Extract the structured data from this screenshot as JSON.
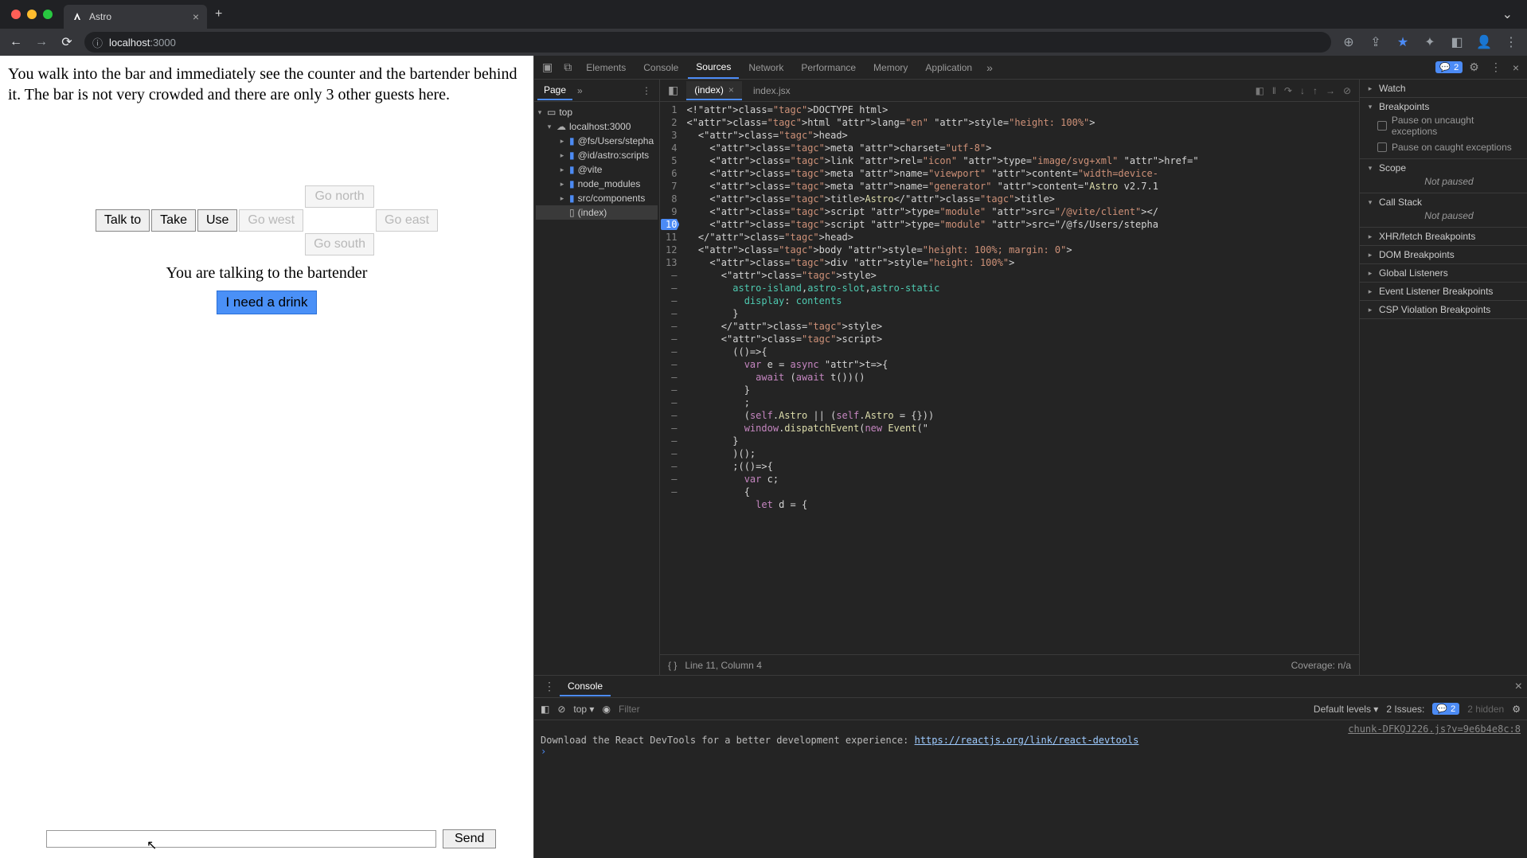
{
  "tab": {
    "title": "Astro"
  },
  "url": {
    "host": "localhost",
    "port": ":3000"
  },
  "page": {
    "narrative": "You walk into the bar and immediately see the counter and the bartender behind it. The bar is not very crowded and there are only 3 other guests here.",
    "actions": {
      "talk": "Talk to",
      "take": "Take",
      "use": "Use"
    },
    "compass": {
      "north": "Go north",
      "south": "Go south",
      "east": "Go east",
      "west": "Go west"
    },
    "talking_to": "You are talking to the bartender",
    "dialog_option": "I need a drink",
    "send": "Send"
  },
  "devtools": {
    "tabs": [
      "Elements",
      "Console",
      "Sources",
      "Network",
      "Performance",
      "Memory",
      "Application"
    ],
    "active_tab": "Sources",
    "issues_count": "2",
    "file_nav_tab": "Page",
    "tree": {
      "top": "top",
      "host": "localhost:3000",
      "folders": [
        "@fs/Users/stepha",
        "@id/astro:scripts",
        "@vite",
        "node_modules",
        "src/components"
      ],
      "file": "(index)"
    },
    "editor_tabs": [
      "(index)",
      "index.jsx"
    ],
    "active_editor_tab": "(index)",
    "line_numbers": [
      "1",
      "2",
      "3",
      "4",
      "5",
      "6",
      "7",
      "8",
      "9",
      "10",
      "11",
      "12",
      "13",
      "–",
      "–",
      "–",
      "–",
      "–",
      "–",
      "–",
      "–",
      "–",
      "–",
      "–",
      "–",
      "–",
      "–",
      "–",
      "–",
      "–",
      "–"
    ],
    "breakpoint_line": "10",
    "status": {
      "cursor": "Line 11, Column 4",
      "coverage": "Coverage: n/a"
    },
    "code_lines": [
      "<!DOCTYPE html>",
      "<html lang=\"en\" style=\"height: 100%\">",
      "  <head>",
      "    <meta charset=\"utf-8\">",
      "    <link rel=\"icon\" type=\"image/svg+xml\" href=\"",
      "    <meta name=\"viewport\" content=\"width=device-",
      "    <meta name=\"generator\" content=\"Astro v2.7.1",
      "    <title>Astro</title>",
      "    <script type=\"module\" src=\"/@vite/client\"></",
      "    <script type=\"module\" src=\"/@fs/Users/stepha",
      "  </head>",
      "  <body style=\"height: 100%; margin: 0\">",
      "    <div style=\"height: 100%\">",
      "      <style>",
      "        astro-island,astro-slot,astro-static",
      "          display: contents",
      "        }",
      "      </style>",
      "      <script>",
      "        (()=>{",
      "          var e = async t=>{",
      "            await (await t())()",
      "          }",
      "          ;",
      "          (self.Astro || (self.Astro = {}))",
      "          window.dispatchEvent(new Event(\"",
      "        }",
      "        )();",
      "        ;(()=>{",
      "          var c;",
      "          {",
      "            let d = {"
    ],
    "right": {
      "watch": "Watch",
      "breakpoints": "Breakpoints",
      "pause_uncaught": "Pause on uncaught exceptions",
      "pause_caught": "Pause on caught exceptions",
      "scope": "Scope",
      "not_paused": "Not paused",
      "callstack": "Call Stack",
      "sections": [
        "XHR/fetch Breakpoints",
        "DOM Breakpoints",
        "Global Listeners",
        "Event Listener Breakpoints",
        "CSP Violation Breakpoints"
      ]
    },
    "console": {
      "tab": "Console",
      "context": "top",
      "filter_placeholder": "Filter",
      "levels": "Default levels ▾",
      "issues_label": "2 Issues:",
      "issues_badge": "2",
      "hidden": "2 hidden",
      "source_link": "chunk-DFKQJ226.js?v=9e6b4e8c:8",
      "message_prefix": "Download the React DevTools for a better development experience: ",
      "message_link": "https://reactjs.org/link/react-devtools"
    }
  }
}
